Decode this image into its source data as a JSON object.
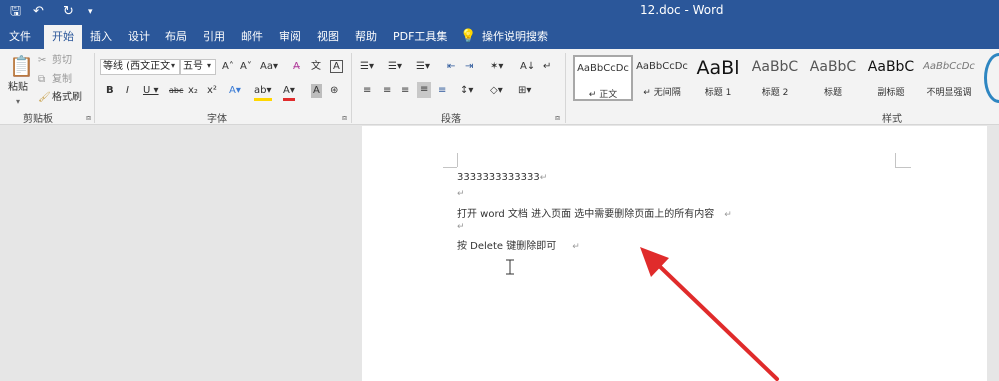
{
  "window": {
    "title": "12.doc  -  Word"
  },
  "quick_access": {
    "save": "🖫",
    "undo": "↶",
    "redo": "↻",
    "customize": "▾"
  },
  "tabs": [
    "文件",
    "开始",
    "插入",
    "设计",
    "布局",
    "引用",
    "邮件",
    "审阅",
    "视图",
    "帮助",
    "PDF工具集"
  ],
  "tell_me": "操作说明搜索",
  "clipboard": {
    "paste": "粘贴",
    "cut": "剪切",
    "copy": "复制",
    "format_painter": "格式刷",
    "label": "剪贴板"
  },
  "font": {
    "name": "等线 (西文正文",
    "size": "五号",
    "label": "字体",
    "row1": [
      "A˄",
      "A˅",
      "Aa▾",
      "A̶",
      "文",
      "A"
    ],
    "row2": [
      "B",
      "I",
      "U ▾",
      "abc",
      "x₂",
      "x²",
      "A▾",
      "ab▾",
      "A▾",
      "A",
      "⊛"
    ]
  },
  "paragraph": {
    "label": "段落",
    "row1": [
      "☰▾",
      "☰▾",
      "☰▾",
      "⇤",
      "⇥",
      "✶▾",
      "A↓",
      "↵"
    ],
    "row2": [
      "≡",
      "≡",
      "≡",
      "≡",
      "≡",
      "↕▾",
      "◇▾",
      "⊞▾"
    ]
  },
  "styles": {
    "label": "样式",
    "items": [
      {
        "sample": "AaBbCcDc",
        "name": "↵ 正文"
      },
      {
        "sample": "AaBbCcDc",
        "name": "↵ 无间隔"
      },
      {
        "sample": "AaBl",
        "name": "标题 1"
      },
      {
        "sample": "AaBbC",
        "name": "标题 2"
      },
      {
        "sample": "AaBbC",
        "name": "标题"
      },
      {
        "sample": "AaBbC",
        "name": "副标题"
      },
      {
        "sample": "AaBbCcDc",
        "name": "不明显强调"
      }
    ]
  },
  "document": {
    "lines": [
      {
        "text": "3333333333333",
        "mark": "↵"
      },
      {
        "text": "",
        "mark": "↵"
      },
      {
        "text": "打开 word 文档    进入页面    选中需要删除页面上的所有内容",
        "mark": "↵"
      },
      {
        "text": "",
        "mark": "↵"
      },
      {
        "text": "按 Delete 键删除即可",
        "mark": "↵"
      }
    ]
  },
  "colors": {
    "accent": "#2b579a",
    "arrow": "#e02b2b",
    "ribbon_bg": "#f3f3f3"
  }
}
